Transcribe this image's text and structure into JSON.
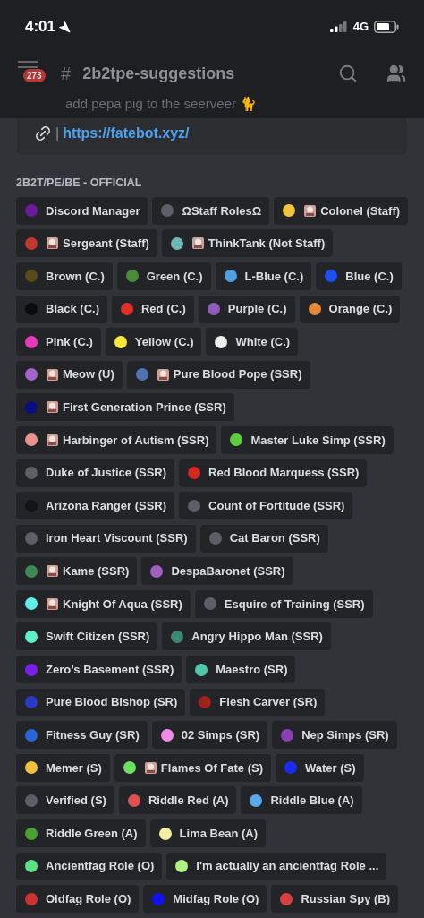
{
  "status_bar": {
    "time": "4:01",
    "network": "4G"
  },
  "header": {
    "unread_badge": "273",
    "hash": "#",
    "channel": "2b2tpe-suggestions"
  },
  "message": {
    "text": "add pepa pig to the seerveer 🐈"
  },
  "links": [
    {
      "separator": "|",
      "url": "https://fatebot.xyz/"
    }
  ],
  "section_title": "2B2T/PE/BE - OFFICIAL",
  "role_rows": [
    [
      {
        "name": "Discord Manager",
        "color": "#6a1b9a",
        "kind": "plain"
      },
      {
        "name": "ΩStaff RolesΩ",
        "color": "#5c5f66",
        "kind": "plain"
      },
      {
        "name": "Colonel (Staff)",
        "color": "#f0c43c",
        "kind": "emoji"
      }
    ],
    [
      {
        "name": "Sergeant (Staff)",
        "color": "#c0392b",
        "kind": "emoji"
      },
      {
        "name": "ThinkTank (Not Staff)",
        "color": "#6fb8b8",
        "kind": "emoji"
      }
    ],
    [
      {
        "name": "Brown (C.)",
        "color": "#5c4a1a",
        "kind": "plain"
      },
      {
        "name": "Green (C.)",
        "color": "#4a8c3a",
        "kind": "plain"
      },
      {
        "name": "L-Blue (C.)",
        "color": "#4fa0e0",
        "kind": "plain"
      },
      {
        "name": "Blue (C.)",
        "color": "#1f4ef0",
        "kind": "plain"
      }
    ],
    [
      {
        "name": "Black (C.)",
        "color": "#0b0b0d",
        "kind": "plain"
      },
      {
        "name": "Red (C.)",
        "color": "#e0302a",
        "kind": "plain"
      },
      {
        "name": "Purple (C.)",
        "color": "#8e5cb8",
        "kind": "plain"
      },
      {
        "name": "Orange (C.)",
        "color": "#e08a3a",
        "kind": "plain"
      }
    ],
    [
      {
        "name": "Pink (C.)",
        "color": "#e83ab8",
        "kind": "plain"
      },
      {
        "name": "Yellow (C.)",
        "color": "#f5e83a",
        "kind": "plain"
      },
      {
        "name": "White (C.)",
        "color": "#eeeeee",
        "kind": "plain"
      }
    ],
    [
      {
        "name": "Meow (U)",
        "color": "#a463c8",
        "kind": "emoji"
      },
      {
        "name": "Pure Blood Pope (SSR)",
        "color": "#4f73b0",
        "kind": "emoji"
      }
    ],
    [
      {
        "name": "First Generation Prince (SSR)",
        "color": "#0a0f80",
        "kind": "emoji"
      }
    ],
    [
      {
        "name": "Harbinger of Autism (SSR)",
        "color": "#e8948a",
        "kind": "emoji"
      },
      {
        "name": "Master Luke Simp (SSR)",
        "color": "#5cd03c",
        "kind": "plain"
      }
    ],
    [
      {
        "name": "Duke of Justice (SSR)",
        "color": "#5c5f66",
        "kind": "plain"
      },
      {
        "name": "Red Blood Marquess (SSR)",
        "color": "#d8261f",
        "kind": "plain"
      }
    ],
    [
      {
        "name": "Arizona Ranger (SSR)",
        "color": "#141418",
        "kind": "plain"
      },
      {
        "name": "Count of Fortitude (SSR)",
        "color": "#5c5f66",
        "kind": "plain"
      }
    ],
    [
      {
        "name": "Iron Heart Viscount (SSR)",
        "color": "#5c5f66",
        "kind": "plain"
      },
      {
        "name": "Cat Baron (SSR)",
        "color": "#5c5f66",
        "kind": "plain"
      }
    ],
    [
      {
        "name": "Kame (SSR)",
        "color": "#3f8a52",
        "kind": "emoji"
      },
      {
        "name": "DespaBaronet (SSR)",
        "color": "#a060c0",
        "kind": "plain"
      }
    ],
    [
      {
        "name": "Knight Of Aqua (SSR)",
        "color": "#5ef0e8",
        "kind": "emoji"
      },
      {
        "name": "Esquire of Training (SSR)",
        "color": "#5c5f66",
        "kind": "plain"
      }
    ],
    [
      {
        "name": "Swift Citizen (SSR)",
        "color": "#5ef0c8",
        "kind": "plain"
      },
      {
        "name": "Angry Hippo Man (SSR)",
        "color": "#3a8a70",
        "kind": "plain"
      }
    ],
    [
      {
        "name": "Zero’s Basement (SSR)",
        "color": "#7a1ef0",
        "kind": "plain"
      },
      {
        "name": "Maestro (SR)",
        "color": "#4ec8a8",
        "kind": "plain"
      }
    ],
    [
      {
        "name": "Pure Blood Bishop (SR)",
        "color": "#2a3ac8",
        "kind": "plain"
      },
      {
        "name": "Flesh Carver (SR)",
        "color": "#a0201a",
        "kind": "plain"
      }
    ],
    [
      {
        "name": "Fitness Guy (SR)",
        "color": "#2a64d8",
        "kind": "plain"
      },
      {
        "name": "02 Simps (SR)",
        "color": "#f08ae8",
        "kind": "plain"
      },
      {
        "name": "Nep Simps (SR)",
        "color": "#8a40b0",
        "kind": "plain"
      }
    ],
    [
      {
        "name": "Memer (S)",
        "color": "#f0c040",
        "kind": "plain"
      },
      {
        "name": "Flames Of Fate (S)",
        "color": "#6ae060",
        "kind": "emoji"
      },
      {
        "name": "Water (S)",
        "color": "#1a2af0",
        "kind": "plain"
      }
    ],
    [
      {
        "name": "Verified (S)",
        "color": "#5c5f66",
        "kind": "plain"
      },
      {
        "name": "Riddle Red (A)",
        "color": "#e05050",
        "kind": "plain"
      },
      {
        "name": "Riddle Blue (A)",
        "color": "#5aa8e8",
        "kind": "plain"
      }
    ],
    [
      {
        "name": "Riddle Green (A)",
        "color": "#4aa030",
        "kind": "plain"
      },
      {
        "name": "Lima Bean (A)",
        "color": "#f0f0a0",
        "kind": "plain"
      }
    ],
    [
      {
        "name": "Ancientfag Role (O)",
        "color": "#5ee08a",
        "kind": "plain"
      },
      {
        "name": "I'm actually an ancientfag Role ...",
        "color": "#b0f080",
        "kind": "plain"
      }
    ],
    [
      {
        "name": "Oldfag Role (O)",
        "color": "#d03030",
        "kind": "plain"
      },
      {
        "name": "Midfag Role (O)",
        "color": "#1010f0",
        "kind": "plain"
      },
      {
        "name": "Russian Spy (B)",
        "color": "#d84040",
        "kind": "plain"
      }
    ]
  ]
}
